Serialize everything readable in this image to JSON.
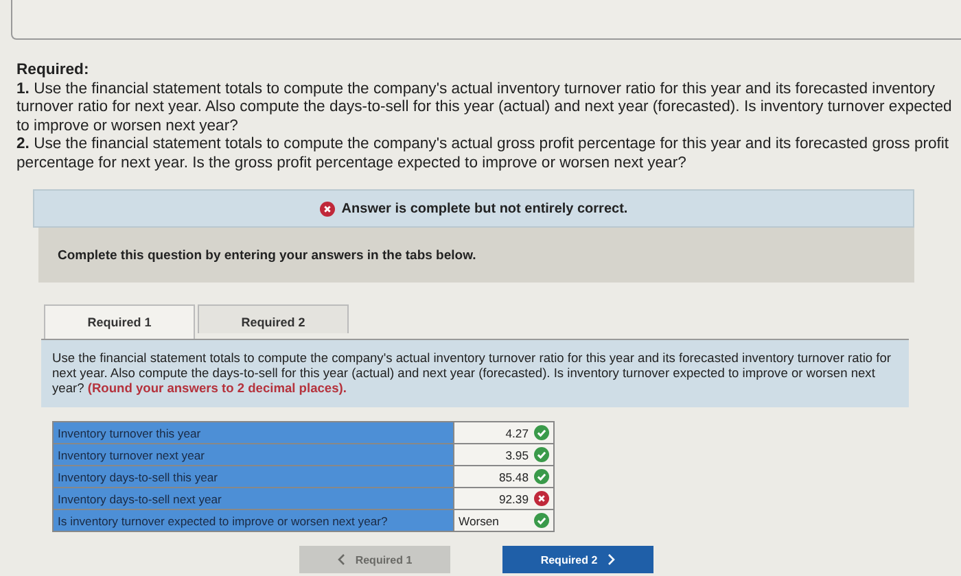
{
  "required": {
    "heading": "Required:",
    "items": [
      {
        "number": "1.",
        "text": "Use the financial statement totals to compute the company's actual inventory turnover ratio for this year and its forecasted inventory turnover ratio for next year. Also compute the days-to-sell for this year (actual) and next year (forecasted). Is inventory turnover expected to improve or worsen next year?"
      },
      {
        "number": "2.",
        "text": "Use the financial statement totals to compute the company's actual gross profit percentage for this year and its forecasted gross profit percentage for next year. Is the gross profit percentage expected to improve or worsen next year?"
      }
    ]
  },
  "result_banner": {
    "correct": false,
    "text": "Answer is complete but not entirely correct."
  },
  "instruction": "Complete this question by entering your answers in the tabs below.",
  "tabs": [
    {
      "label": "Required 1",
      "selected": true
    },
    {
      "label": "Required 2",
      "selected": false
    }
  ],
  "question": {
    "text": "Use the financial statement totals to compute the company's actual inventory turnover ratio for this year and its forecasted inventory turnover ratio for next year. Also compute the days-to-sell for this year (actual) and next year (forecasted). Is inventory turnover expected to improve or worsen next year?",
    "note": "(Round your answers to 2 decimal places)."
  },
  "answers": [
    {
      "label": "Inventory turnover this year",
      "value": "4.27",
      "correct": true,
      "kind": "number"
    },
    {
      "label": "Inventory turnover next year",
      "value": "3.95",
      "correct": true,
      "kind": "number"
    },
    {
      "label": "Inventory days-to-sell this year",
      "value": "85.48",
      "correct": true,
      "kind": "number"
    },
    {
      "label": "Inventory days-to-sell next year",
      "value": "92.39",
      "correct": false,
      "kind": "number"
    },
    {
      "label": "Is inventory turnover expected to improve or worsen next year?",
      "value": "Worsen",
      "correct": true,
      "kind": "choice"
    }
  ],
  "nav": {
    "prev": {
      "label": "Required 1",
      "disabled": true
    },
    "next": {
      "label": "Required 2",
      "disabled": false
    }
  }
}
